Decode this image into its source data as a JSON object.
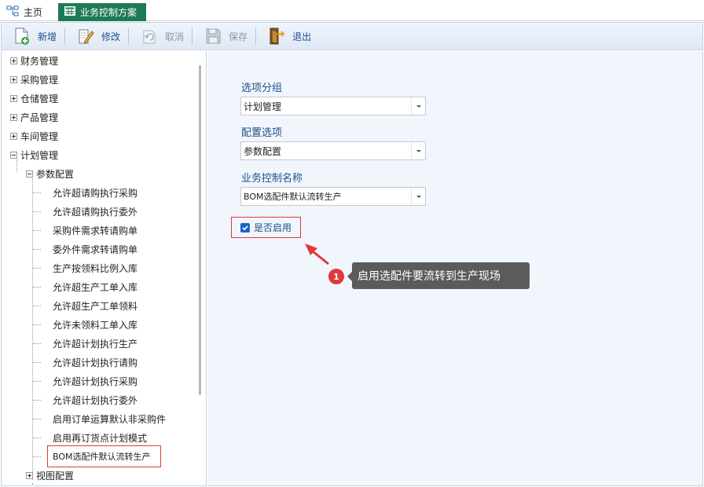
{
  "tabs": [
    {
      "label": "主页",
      "active": false,
      "icon": "hierarchy-icon"
    },
    {
      "label": "业务控制方案",
      "active": true,
      "icon": "table-icon"
    }
  ],
  "toolbar": {
    "new_label": "新增",
    "edit_label": "修改",
    "cancel_label": "取消",
    "save_label": "保存",
    "exit_label": "退出"
  },
  "tree": {
    "roots": [
      "财务管理",
      "采购管理",
      "仓储管理",
      "产品管理",
      "车间管理",
      "计划管理"
    ],
    "group_param": "参数配置",
    "leaves": [
      "允许超请购执行采购",
      "允许超请购执行委外",
      "采购件需求转请购单",
      "委外件需求转请购单",
      "生产按领料比例入库",
      "允许超生产工单入库",
      "允许超生产工单领料",
      "允许未领料工单入库",
      "允许超计划执行生产",
      "允许超计划执行请购",
      "允许超计划执行采购",
      "允许超计划执行委外",
      "启用订单运算默认非采购件",
      "启用再订货点计划模式",
      "BOM选配件默认流转生产"
    ],
    "group_view": "视图配置"
  },
  "form": {
    "group_label": "选项分组",
    "group_value": "计划管理",
    "config_label": "配置选项",
    "config_value": "参数配置",
    "name_label": "业务控制名称",
    "name_value": "BOM选配件默认流转生产",
    "enable_label": "是否启用",
    "enabled": true
  },
  "annotation": {
    "number": "1",
    "text": "启用选配件要流转到生产现场"
  },
  "colors": {
    "accent": "#1f4e8c",
    "active_tab": "#1e7a55",
    "highlight": "#e0393b",
    "callout": "#5b5b5b"
  }
}
